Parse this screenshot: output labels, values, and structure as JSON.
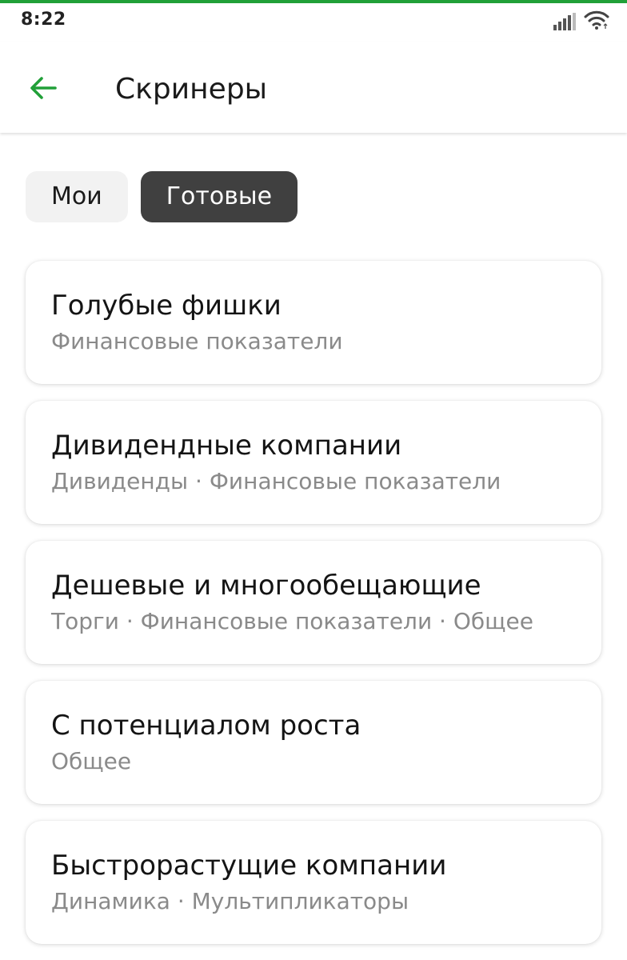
{
  "status_bar": {
    "time": "8:22",
    "icons": [
      "signal-icon",
      "wifi-icon"
    ]
  },
  "colors": {
    "accent": "#21a038",
    "tab_active_bg": "#404040",
    "tab_inactive_bg": "#f2f2f2",
    "subtitle": "#8a8a8a"
  },
  "header": {
    "back_icon": "arrow-left-icon",
    "title": "Скринеры"
  },
  "tabs": [
    {
      "label": "Мои",
      "active": false
    },
    {
      "label": "Готовые",
      "active": true
    }
  ],
  "screeners": [
    {
      "title": "Голубые фишки",
      "subtitle": "Финансовые показатели"
    },
    {
      "title": "Дивидендные компании",
      "subtitle": "Дивиденды · Финансовые показатели"
    },
    {
      "title": "Дешевые и многообещающие",
      "subtitle": "Торги · Финансовые показатели · Общее"
    },
    {
      "title": "С потенциалом роста",
      "subtitle": "Общее"
    },
    {
      "title": "Быстрорастущие компании",
      "subtitle": "Динамика · Мультипликаторы"
    }
  ]
}
